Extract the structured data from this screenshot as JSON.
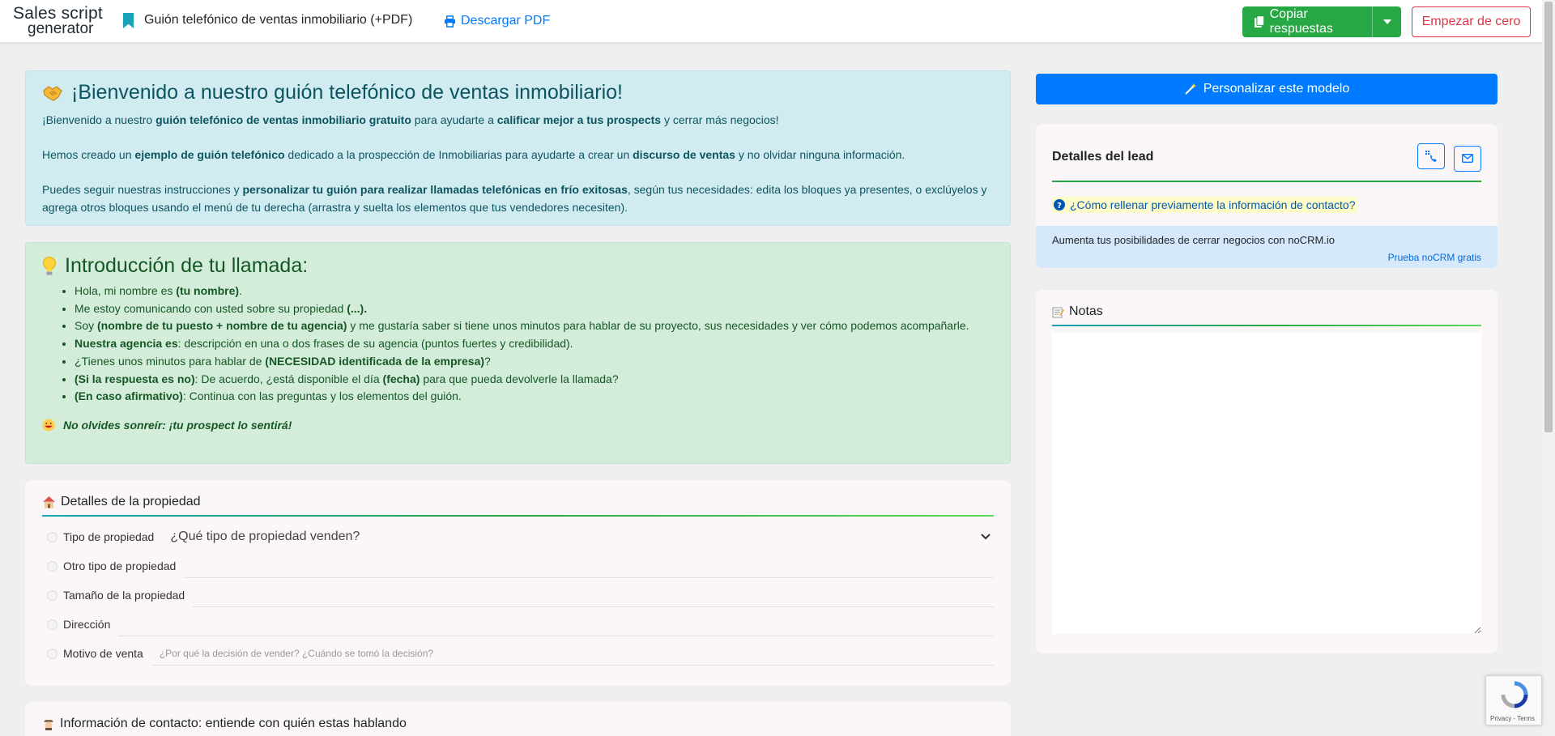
{
  "header": {
    "logo_line1": "Sales script",
    "logo_line2": "generator",
    "title": "Guión telefónico de ventas inmobiliario (+PDF)",
    "download_label": "Descargar PDF",
    "copy_label": "Copiar respuestas",
    "reset_label": "Empezar de cero"
  },
  "welcome": {
    "title": "¡Bienvenido a nuestro guión telefónico de ventas inmobiliario!",
    "p1": [
      {
        "t": "¡Bienvenido a nuestro ",
        "b": false
      },
      {
        "t": "guión telefónico de ventas inmobiliario gratuito",
        "b": true
      },
      {
        "t": " para ayudarte a ",
        "b": false
      },
      {
        "t": "calificar mejor a tus prospects",
        "b": true
      },
      {
        "t": " y cerrar más negocios!",
        "b": false
      }
    ],
    "p2": [
      {
        "t": "Hemos creado un ",
        "b": false
      },
      {
        "t": "ejemplo de guión telefónico",
        "b": true
      },
      {
        "t": " dedicado a la prospección de Inmobiliarias para ayudarte a crear un ",
        "b": false
      },
      {
        "t": "discurso de ventas",
        "b": true
      },
      {
        "t": " y no olvidar ninguna información.",
        "b": false
      }
    ],
    "p3": [
      {
        "t": "Puedes seguir nuestras instrucciones y ",
        "b": false
      },
      {
        "t": "personalizar tu guión para realizar llamadas telefónicas en frío exitosas",
        "b": true
      },
      {
        "t": ", según tus necesidades: edita los bloques ya presentes, o exclúyelos y agrega otros bloques usando el menú de tu derecha (arrastra y suelta los elementos que tus vendedores necesiten).",
        "b": false
      }
    ]
  },
  "intro": {
    "title": "Introducción de tu llamada:",
    "items": [
      [
        {
          "t": "Hola, mi nombre es ",
          "b": false
        },
        {
          "t": "(tu nombre)",
          "b": true
        },
        {
          "t": ".",
          "b": false
        }
      ],
      [
        {
          "t": "Me estoy comunicando con usted sobre su propiedad ",
          "b": false
        },
        {
          "t": "(...).",
          "b": true
        }
      ],
      [
        {
          "t": "Soy ",
          "b": false
        },
        {
          "t": "(nombre de tu puesto + nombre de tu agencia)",
          "b": true
        },
        {
          "t": " y me gustaría saber si tiene unos minutos para hablar de su proyecto, sus necesidades y ver cómo podemos acompañarle.",
          "b": false
        }
      ],
      [
        {
          "t": "Nuestra agencia es",
          "b": true
        },
        {
          "t": ": descripción en una o dos frases de su agencia (puntos fuertes y credibilidad).",
          "b": false
        }
      ],
      [
        {
          "t": "¿Tienes unos minutos para hablar de ",
          "b": false
        },
        {
          "t": "(NECESIDAD identificada de la empresa)",
          "b": true
        },
        {
          "t": "?",
          "b": false
        }
      ],
      [
        {
          "t": "(Si la respuesta es no)",
          "b": true
        },
        {
          "t": ": De acuerdo, ¿está disponible el día ",
          "b": false
        },
        {
          "t": "(fecha)",
          "b": true
        },
        {
          "t": " para que pueda devolverle la llamada?",
          "b": false
        }
      ],
      [
        {
          "t": "(En caso afirmativo)",
          "b": true
        },
        {
          "t": ": Continua con las preguntas y los elementos del guión.",
          "b": false
        }
      ]
    ],
    "smile_note": "No olvides sonreír: ¡tu prospect lo sentirá!"
  },
  "property": {
    "title": "Detalles de la propiedad",
    "type_label": "Tipo de propiedad",
    "type_placeholder": "¿Qué tipo de propiedad venden?",
    "other_label": "Otro tipo de propiedad",
    "size_label": "Tamaño de la propiedad",
    "address_label": "Dirección",
    "reason_label": "Motivo de venta",
    "reason_placeholder": "¿Por qué la decisión de vender? ¿Cuándo se tomó la decisión?"
  },
  "contact": {
    "title": "Información de contacto: entiende con quién estas hablando"
  },
  "sidebar": {
    "personalize_label": "Personalizar este modelo",
    "lead_title": "Detalles del lead",
    "help_link": "¿Cómo rellenar previamente la información de contacto?",
    "banner_text": "Aumenta tus posibilidades de cerrar negocios con noCRM.io",
    "trial_link": "Prueba noCRM gratis",
    "notes_title": "Notas"
  },
  "recaptcha": {
    "terms": "Privacy - Terms"
  },
  "colors": {
    "primary": "#007bff",
    "success": "#28a745",
    "danger": "#dc3545",
    "info_bg": "#d1ecf1",
    "success_bg": "#d4edda"
  }
}
